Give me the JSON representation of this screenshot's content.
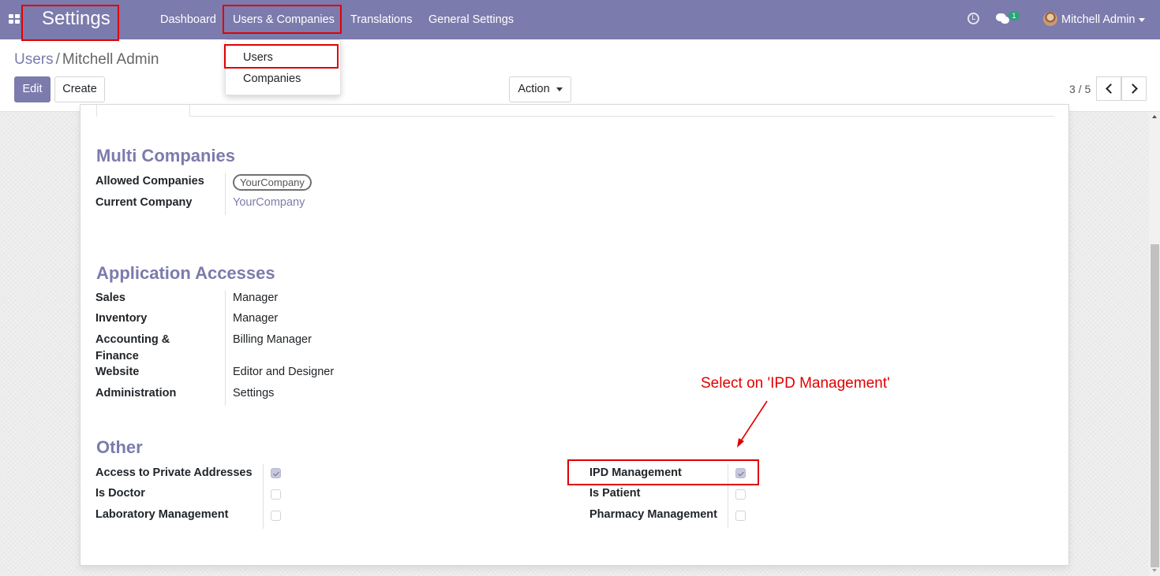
{
  "navbar": {
    "app_title": "Settings",
    "menus": [
      "Dashboard",
      "Users & Companies",
      "Translations",
      "General Settings"
    ],
    "chat_badge": "1",
    "user_name": "Mitchell Admin"
  },
  "dropdown": {
    "items": [
      "Users",
      "Companies"
    ]
  },
  "breadcrumb": {
    "parent": "Users",
    "separator": "/",
    "current": "Mitchell Admin"
  },
  "toolbar": {
    "edit": "Edit",
    "create": "Create",
    "action": "Action"
  },
  "pager": {
    "value": "3 / 5"
  },
  "multi_companies": {
    "title": "Multi Companies",
    "allowed_label": "Allowed Companies",
    "allowed_tag": "YourCompany",
    "current_label": "Current Company",
    "current_value": "YourCompany"
  },
  "app_access": {
    "title": "Application Accesses",
    "rows": [
      {
        "label": "Sales",
        "value": "Manager"
      },
      {
        "label": "Inventory",
        "value": "Manager"
      },
      {
        "label": "Accounting & Finance",
        "value": "Billing Manager"
      },
      {
        "label": "Website",
        "value": "Editor and Designer"
      },
      {
        "label": "Administration",
        "value": "Settings"
      }
    ]
  },
  "other": {
    "title": "Other",
    "left": [
      {
        "label": "Access to Private Addresses",
        "checked": true
      },
      {
        "label": "Is Doctor",
        "checked": false
      },
      {
        "label": "Laboratory Management",
        "checked": false
      }
    ],
    "right": [
      {
        "label": "IPD Management",
        "checked": true
      },
      {
        "label": "Is Patient",
        "checked": false
      },
      {
        "label": "Pharmacy Management",
        "checked": false
      }
    ]
  },
  "annotation": {
    "note": "Select on 'IPD Management'",
    "color": "#e00000"
  },
  "colors": {
    "brand": "#7c7bad",
    "badge": "#2aa37c"
  }
}
